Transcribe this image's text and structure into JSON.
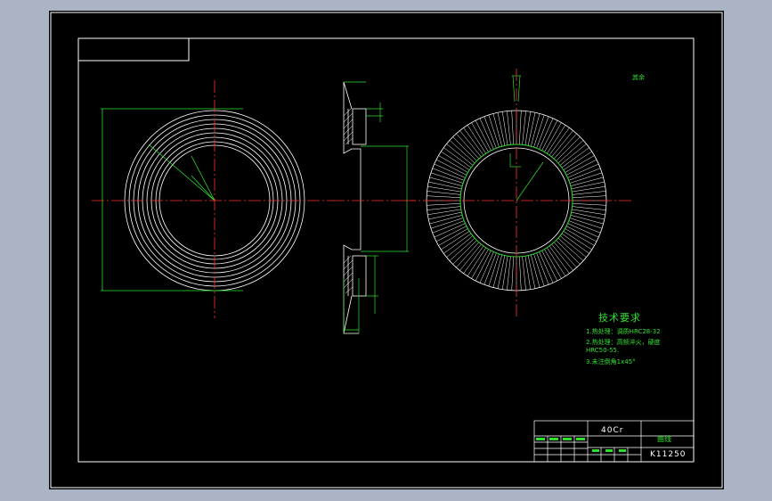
{
  "drawing": {
    "technical_requirements": {
      "title": "技术要求",
      "items": [
        "1.热处理：调质HRC28-32",
        "2.热处理：高频淬火，硬度",
        "HRC50-55.",
        "3.未注倒角1x45°"
      ]
    },
    "title_block": {
      "material": "40Cr",
      "part_name": "曲线",
      "drawing_code": "K11250"
    },
    "roughness_note": "其余"
  },
  "colors": {
    "sheet": "#000000",
    "outline": "#ffffff",
    "centerline": "#ff3030",
    "dimension": "#2fe02f",
    "viewport": "#aab4c4"
  }
}
